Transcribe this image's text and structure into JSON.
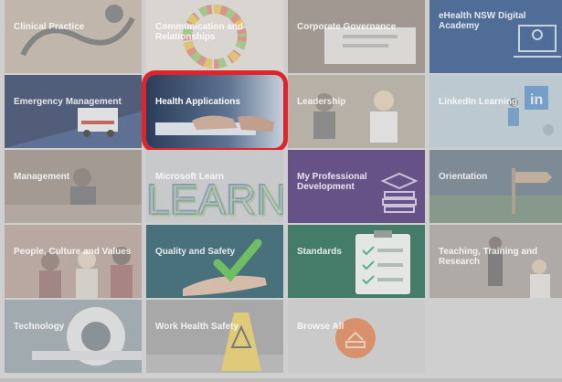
{
  "tiles": [
    {
      "label": "Clinical Practice",
      "bg": "#7c6b5a",
      "art": "stethoscope"
    },
    {
      "label": "Communication and Relationships",
      "bg": "#e7e1d8",
      "art": "color-ring"
    },
    {
      "label": "Corporate Governance",
      "bg": "#6a5848",
      "art": "desk"
    },
    {
      "label": "eHealth NSW Digital Academy",
      "bg": "#0d3a7a",
      "art": "laptop-person-icon"
    },
    {
      "label": "Emergency Management",
      "bg": "#1d2f55",
      "art": "ambulance"
    },
    {
      "label": "Health Applications",
      "bg": "#4b5f7a",
      "art": "keyboard-hands",
      "active": true
    },
    {
      "label": "Leadership",
      "bg": "#9c8c78",
      "art": "people-meeting"
    },
    {
      "label": "LinkedIn Learning",
      "bg": "#a9c4d6",
      "art": "linkedin-figure"
    },
    {
      "label": "Management",
      "bg": "#6e5b4d",
      "art": "people-meeting"
    },
    {
      "label": "Microsoft Learn",
      "bg": "#bfc3c8",
      "art": "learn-letters"
    },
    {
      "label": "My Professional Development",
      "bg": "#3b1d6b",
      "art": "books-icon"
    },
    {
      "label": "Orientation",
      "bg": "#1f3a4e",
      "art": "signpost"
    },
    {
      "label": "People, Culture and Values",
      "bg": "#a07a6a",
      "art": "group-people"
    },
    {
      "label": "Quality and Safety",
      "bg": "#0f4a5a",
      "art": "hand-check"
    },
    {
      "label": "Standards",
      "bg": "#0b5a3e",
      "art": "clipboard-checklist"
    },
    {
      "label": "Teaching, Training and Research",
      "bg": "#8a7f77",
      "art": "classroom"
    },
    {
      "label": "Technology",
      "bg": "#6c7f88",
      "art": "scanner"
    },
    {
      "label": "Work Health Safety",
      "bg": "#7a7a7a",
      "art": "wet-floor-sign"
    },
    {
      "label": "Browse All",
      "bg": "#c8c8c8",
      "art": "browse-circle-icon"
    },
    {
      "label": "",
      "bg": "transparent",
      "art": ""
    }
  ],
  "colors": {
    "highlight": "#e0242a",
    "browse_accent": "#e06a2a"
  }
}
